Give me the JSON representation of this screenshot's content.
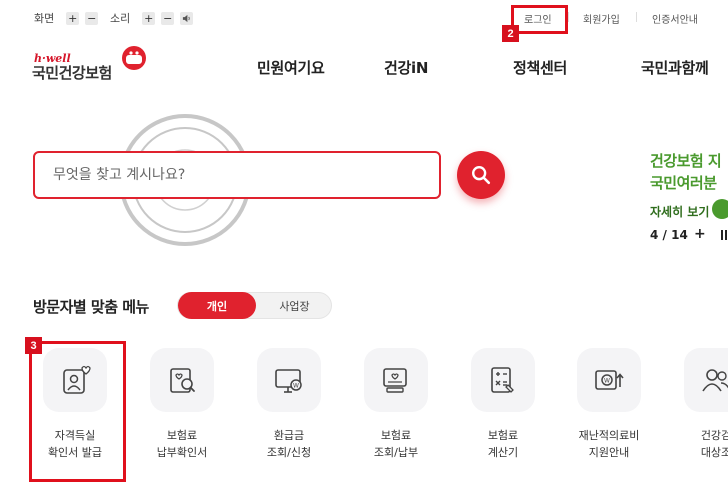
{
  "util": {
    "screen_label": "화면",
    "sound_label": "소리",
    "plus": "+",
    "minus": "−",
    "links": [
      "로그인",
      "회원가입",
      "인증서안내"
    ]
  },
  "logo": {
    "sub": "h·well",
    "main": "국민건강보험"
  },
  "nav": [
    "민원여기요",
    "건강iN",
    "정책센터",
    "국민과함께"
  ],
  "search": {
    "placeholder": "무엇을 찾고 계시나요?"
  },
  "banner": {
    "line1": "건강보험 지",
    "line2": "국민여러분",
    "more": "자세히 보기",
    "page": "4 / 14",
    "next": "+"
  },
  "section": {
    "title": "방문자별 맞춤 메뉴"
  },
  "toggle": {
    "on": "개인",
    "off": "사업장"
  },
  "tiles": [
    {
      "l1": "자격득실",
      "l2": "확인서 발급",
      "icon": "person-heart-icon"
    },
    {
      "l1": "보험료",
      "l2": "납부확인서",
      "icon": "document-search-icon"
    },
    {
      "l1": "환급금",
      "l2": "조회/신청",
      "icon": "monitor-won-icon"
    },
    {
      "l1": "보험료",
      "l2": "조회/납부",
      "icon": "monitor-heart-icon"
    },
    {
      "l1": "보험료",
      "l2": "계산기",
      "icon": "calculator-icon"
    },
    {
      "l1": "재난적의료비",
      "l2": "지원안내",
      "icon": "card-won-icon"
    },
    {
      "l1": "건강검",
      "l2": "대상조",
      "icon": "people-icon"
    }
  ],
  "annotations": [
    "2",
    "3"
  ],
  "colors": {
    "accent": "#e0222e",
    "banner_green": "#4a9a2e",
    "annotation_red": "#e0101c"
  }
}
